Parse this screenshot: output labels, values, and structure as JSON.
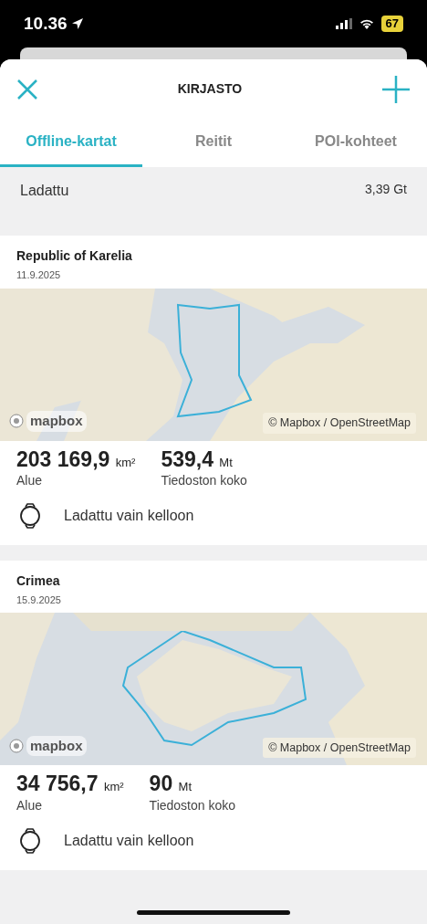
{
  "status_bar": {
    "time": "10.36",
    "battery": "67"
  },
  "header": {
    "title": "KIRJASTO"
  },
  "tabs": [
    {
      "label": "Offline-kartat",
      "selected": true
    },
    {
      "label": "Reitit",
      "selected": false
    },
    {
      "label": "POI-kohteet",
      "selected": false
    }
  ],
  "summary": {
    "label": "Ladattu",
    "value": "3,39 Gt"
  },
  "maps": [
    {
      "name": "Republic of Karelia",
      "date": "11.9.2025",
      "map": {
        "kind": "picture",
        "logo": "mapbox",
        "attribution": "© Mapbox / OpenStreetMap"
      },
      "area": "203 169,9",
      "area_unit": "km²",
      "area_label": "Alue",
      "size": "539,4",
      "size_unit": "Mt",
      "size_label": "Tiedoston koko",
      "storage": "Ladattu vain kelloon"
    },
    {
      "name": "Crimea",
      "date": "15.9.2025",
      "map": {
        "kind": "picture",
        "logo": "mapbox",
        "attribution": "© Mapbox / OpenStreetMap"
      },
      "area": "34 756,7",
      "area_unit": "km²",
      "area_label": "Alue",
      "size": "90",
      "size_unit": "Mt",
      "size_label": "Tiedoston koko",
      "storage": "Ladattu vain kelloon"
    }
  ]
}
